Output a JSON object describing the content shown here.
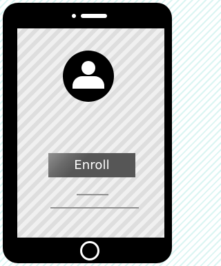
{
  "device": {
    "frame_color": "#000000",
    "screen_color": "#dedede",
    "accent_color": "#ffffff"
  },
  "screen": {
    "avatar_icon": "user-icon",
    "enroll_button": {
      "label": "Enroll",
      "background": "#565656"
    },
    "divider_color": "#8f8f8f"
  },
  "hardware": {
    "home_button_icon": "home-button-ring"
  }
}
